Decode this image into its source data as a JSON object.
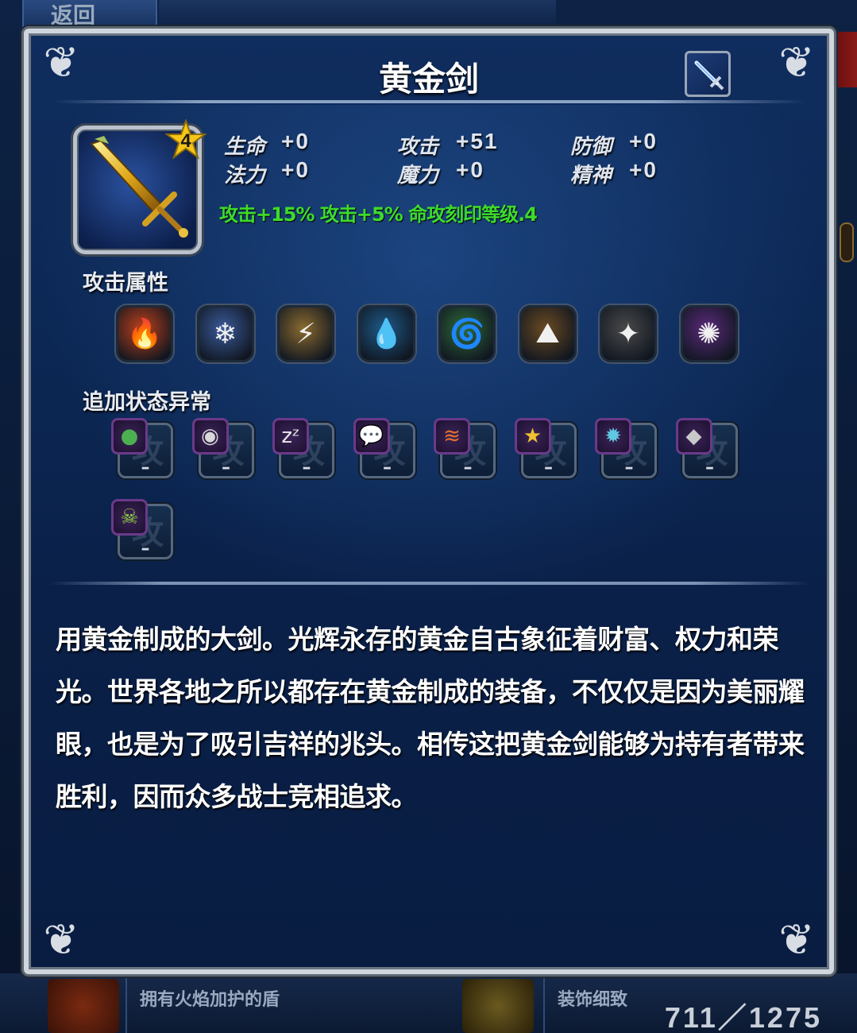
{
  "background": {
    "back_label": "返回",
    "items": [
      {
        "label": "拥有火焰加护的盾"
      },
      {
        "label": "装饰细致"
      }
    ],
    "counter": "711／1275"
  },
  "dialog": {
    "title": "黄金剑",
    "type_icon": "sword-icon",
    "item": {
      "icon": "golden-sword-icon",
      "rank": "4"
    },
    "stats": [
      {
        "label": "生命",
        "value": "+0"
      },
      {
        "label": "攻击",
        "value": "+51"
      },
      {
        "label": "防御",
        "value": "+0"
      },
      {
        "label": "法力",
        "value": "+0"
      },
      {
        "label": "魔力",
        "value": "+0"
      },
      {
        "label": "精神",
        "value": "+0"
      }
    ],
    "bonus_text": "攻击+15% 攻击+5% 命攻刻印等级.4",
    "attack_attributes_label": "攻击属性",
    "elements": [
      {
        "name": "fire-icon",
        "color": "#c0401a",
        "glyph": "🔥"
      },
      {
        "name": "ice-icon",
        "color": "#3a5a9a",
        "glyph": "❄"
      },
      {
        "name": "lightning-icon",
        "color": "#8a6a30",
        "glyph": "⚡"
      },
      {
        "name": "water-icon",
        "color": "#1e5a8a",
        "glyph": "💧"
      },
      {
        "name": "wind-icon",
        "color": "#2e6a3a",
        "glyph": "🌀"
      },
      {
        "name": "earth-icon",
        "color": "#6a4a22",
        "glyph": "⛰"
      },
      {
        "name": "holy-icon",
        "color": "#4a4a4a",
        "glyph": "✦"
      },
      {
        "name": "dark-icon",
        "color": "#5a2a7a",
        "glyph": "✺"
      }
    ],
    "status_label": "追加状态异常",
    "statuses": [
      {
        "name": "poison-icon",
        "glyph": "●",
        "color": "#4caf50",
        "value": "–",
        "ghost": "攻"
      },
      {
        "name": "blind-icon",
        "glyph": "◉",
        "color": "#d8d8d8",
        "value": "–",
        "ghost": "攻"
      },
      {
        "name": "sleep-icon",
        "glyph": "zᶻ",
        "color": "#e8e8e8",
        "value": "–",
        "ghost": "攻"
      },
      {
        "name": "silence-icon",
        "glyph": "💬",
        "color": "#ffffff",
        "value": "–",
        "ghost": "攻"
      },
      {
        "name": "paralyze-icon",
        "glyph": "≋",
        "color": "#e8702a",
        "value": "–",
        "ghost": "攻"
      },
      {
        "name": "confuse-icon",
        "glyph": "★",
        "color": "#f0c030",
        "value": "–",
        "ghost": "攻"
      },
      {
        "name": "stun-icon",
        "glyph": "✹",
        "color": "#60c8e0",
        "value": "–",
        "ghost": "攻"
      },
      {
        "name": "petrify-icon",
        "glyph": "◆",
        "color": "#c8c8c8",
        "value": "–",
        "ghost": "攻"
      },
      {
        "name": "death-icon",
        "glyph": "☠",
        "color": "#8fd040",
        "value": "–",
        "ghost": "攻"
      }
    ],
    "description": "用黄金制成的大剑。光辉永存的黄金自古象征着财富、权力和荣光。世界各地之所以都存在黄金制成的装备，不仅仅是因为美丽耀眼，也是为了吸引吉祥的兆头。相传这把黄金剑能够为持有者带来胜利，因而众多战士竞相追求。"
  }
}
